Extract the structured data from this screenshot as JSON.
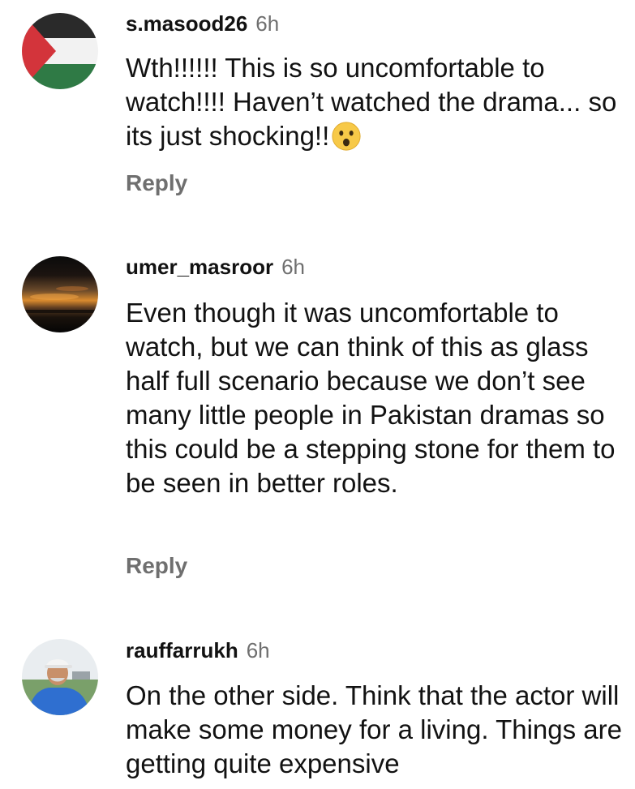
{
  "comments": [
    {
      "username": "s.masood26",
      "time": "6h",
      "text": "Wth!!!!!! This is so uncomfortable to watch!!!! Haven’t watched the drama... so its just shocking!!",
      "emoji": "hushed-face-emoji",
      "reply_label": "Reply",
      "avatar": "palestine-flag-avatar"
    },
    {
      "username": "umer_masroor",
      "time": "6h",
      "text": "Even though it was uncomfortable to watch, but we can think of this as glass half full scenario because we don’t see many little people in Pakistan dramas so this could be a stepping stone for them to be seen in better roles.",
      "reply_label": "Reply",
      "avatar": "sunset-avatar"
    },
    {
      "username": "rauffarrukh",
      "time": "6h",
      "text": "On the other side. Think that the actor will make some money for a living. Things are getting quite expensive",
      "avatar": "man-in-cap-avatar"
    }
  ],
  "colors": {
    "text": "#121212",
    "secondary": "#6f6f6f",
    "background": "#ffffff"
  }
}
